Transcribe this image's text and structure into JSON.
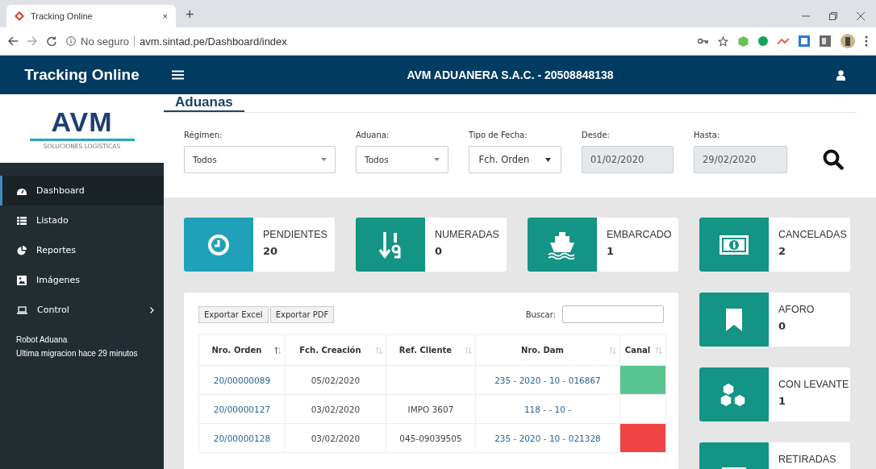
{
  "browser": {
    "tab_title": "Tracking Online",
    "close": "×",
    "new_tab": "+",
    "security": "No seguro",
    "url": "avm.sintad.pe/Dashboard/index"
  },
  "header": {
    "brand": "Tracking Online",
    "company": "AVM ADUANERA S.A.C. - 20508848138"
  },
  "logo": {
    "text": "AVM",
    "tagline": "SOLUCIONES LOGÍSTICAS"
  },
  "sidebar": {
    "items": [
      {
        "label": "Dashboard",
        "selected": true
      },
      {
        "label": "Listado",
        "selected": false
      },
      {
        "label": "Reportes",
        "selected": false
      },
      {
        "label": "Imágenes",
        "selected": false
      },
      {
        "label": "Control",
        "selected": false
      }
    ],
    "status": [
      "Robot Aduana",
      "Ultima migracion hace 29 minutos"
    ]
  },
  "tabs": [
    {
      "label": "Aduanas",
      "selected": true
    }
  ],
  "filters": [
    {
      "label": "Régimen:",
      "value": "Todos",
      "kind": "select"
    },
    {
      "label": "Aduana:",
      "value": "Todos",
      "kind": "select"
    },
    {
      "label": "Tipo de Fecha:",
      "value": "Fch. Orden",
      "kind": "native"
    },
    {
      "label": "Desde:",
      "value": "01/02/2020",
      "kind": "date"
    },
    {
      "label": "Hasta:",
      "value": "29/02/2020",
      "kind": "date"
    }
  ],
  "cards": [
    {
      "label": "PENDIENTES",
      "count": "20",
      "color": "#1fa2b9"
    },
    {
      "label": "NUMERADAS",
      "count": "0",
      "color": "#139484"
    },
    {
      "label": "EMBARCADO",
      "count": "1",
      "color": "#139484"
    },
    {
      "label": "CANCELADAS",
      "count": "2",
      "color": "#139484"
    }
  ],
  "side_cards": [
    {
      "label": "AFORO",
      "count": "0",
      "color": "#139484"
    },
    {
      "label": "CON LEVANTE",
      "count": "1",
      "color": "#139484"
    },
    {
      "label": "RETIRADAS",
      "color": "#139484"
    }
  ],
  "table": {
    "buttons": [
      "Exportar Excel",
      "Exportar PDF"
    ],
    "search_label": "Buscar:",
    "columns": [
      {
        "label": "Nro. Orden",
        "sorted": true
      },
      {
        "label": "Fch. Creación",
        "sorted": false
      },
      {
        "label": "Ref. Cliente",
        "sorted": false
      },
      {
        "label": "Nro. Dam",
        "sorted": false
      },
      {
        "label": "Canal",
        "sorted": false
      }
    ],
    "rows": [
      {
        "order": "20/00000089",
        "created": "05/02/2020",
        "dam": "235 - 2020 - 10 - 016867",
        "color": "#58c591"
      },
      {
        "order": "20/00000127",
        "created": "03/02/2020",
        "ref": "IMPO 3607",
        "dam": "118 - - 10 -"
      },
      {
        "order": "20/00000128",
        "created": "03/02/2020",
        "ref": "045-09039505",
        "dam": "235 - 2020 - 10 - 021328",
        "color": "#f04343"
      }
    ]
  }
}
